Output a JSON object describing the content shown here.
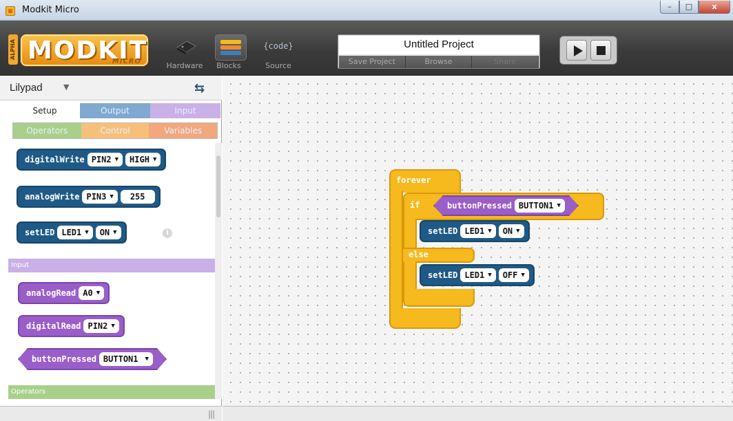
{
  "window": {
    "title": "Modkit Micro",
    "controls": [
      "–",
      "□",
      "x"
    ]
  },
  "toolbar": {
    "alpha_label": "ALPHA",
    "logo_text": "MODKIT",
    "logo_sub": "MICRO",
    "tools": [
      {
        "label": "Hardware",
        "icon": "chip-icon"
      },
      {
        "label": "Blocks",
        "icon": "blocks-icon",
        "active": true
      },
      {
        "label": "Source",
        "icon": "code-icon",
        "glyph": "{code}"
      }
    ],
    "project": {
      "title": "Untitled Project",
      "actions": [
        {
          "label": "Save Project",
          "enabled": true
        },
        {
          "label": "Browse",
          "enabled": true
        },
        {
          "label": "Share",
          "enabled": false
        }
      ]
    }
  },
  "sidebar": {
    "board": "Lilypad",
    "tabs_row1": [
      {
        "label": "Setup",
        "color": "#ffffff",
        "text_color": "#222222",
        "selected": true
      },
      {
        "label": "Output",
        "color": "#7fa9cf"
      },
      {
        "label": "Input",
        "color": "#c9b0e6"
      }
    ],
    "tabs_row2": [
      {
        "label": "Operators",
        "color": "#a8d08a"
      },
      {
        "label": "Control",
        "color": "#f7c07a"
      },
      {
        "label": "Variables",
        "color": "#f2a77e"
      }
    ],
    "sections": {
      "input": "Input",
      "operators": "Operators"
    },
    "palette_blocks": {
      "digitalWrite": {
        "label": "digitalWrite",
        "args": [
          "PIN2",
          "HIGH"
        ]
      },
      "analogWrite": {
        "label": "analogWrite",
        "args": [
          "PIN3"
        ],
        "value": "255"
      },
      "setLED": {
        "label": "setLED",
        "args": [
          "LED1",
          "ON"
        ]
      },
      "analogRead": {
        "label": "analogRead",
        "args": [
          "A0"
        ]
      },
      "digitalRead": {
        "label": "digitalRead",
        "args": [
          "PIN2"
        ]
      },
      "buttonPressed": {
        "label": "buttonPressed",
        "args": [
          "BUTTON1"
        ]
      }
    },
    "grip": "|||"
  },
  "program": {
    "forever": "forever",
    "if": "if",
    "else": "else",
    "condition": {
      "label": "buttonPressed",
      "arg": "BUTTON1"
    },
    "then_block": {
      "label": "setLED",
      "args": [
        "LED1",
        "ON"
      ]
    },
    "else_block": {
      "label": "setLED",
      "args": [
        "LED1",
        "OFF"
      ]
    }
  },
  "colors": {
    "output_block": "#1f5a86",
    "input_block": "#9a5ec9",
    "control_block": "#f6b91e",
    "section_input": "#c9b0e6",
    "section_operators": "#a8d08a"
  }
}
